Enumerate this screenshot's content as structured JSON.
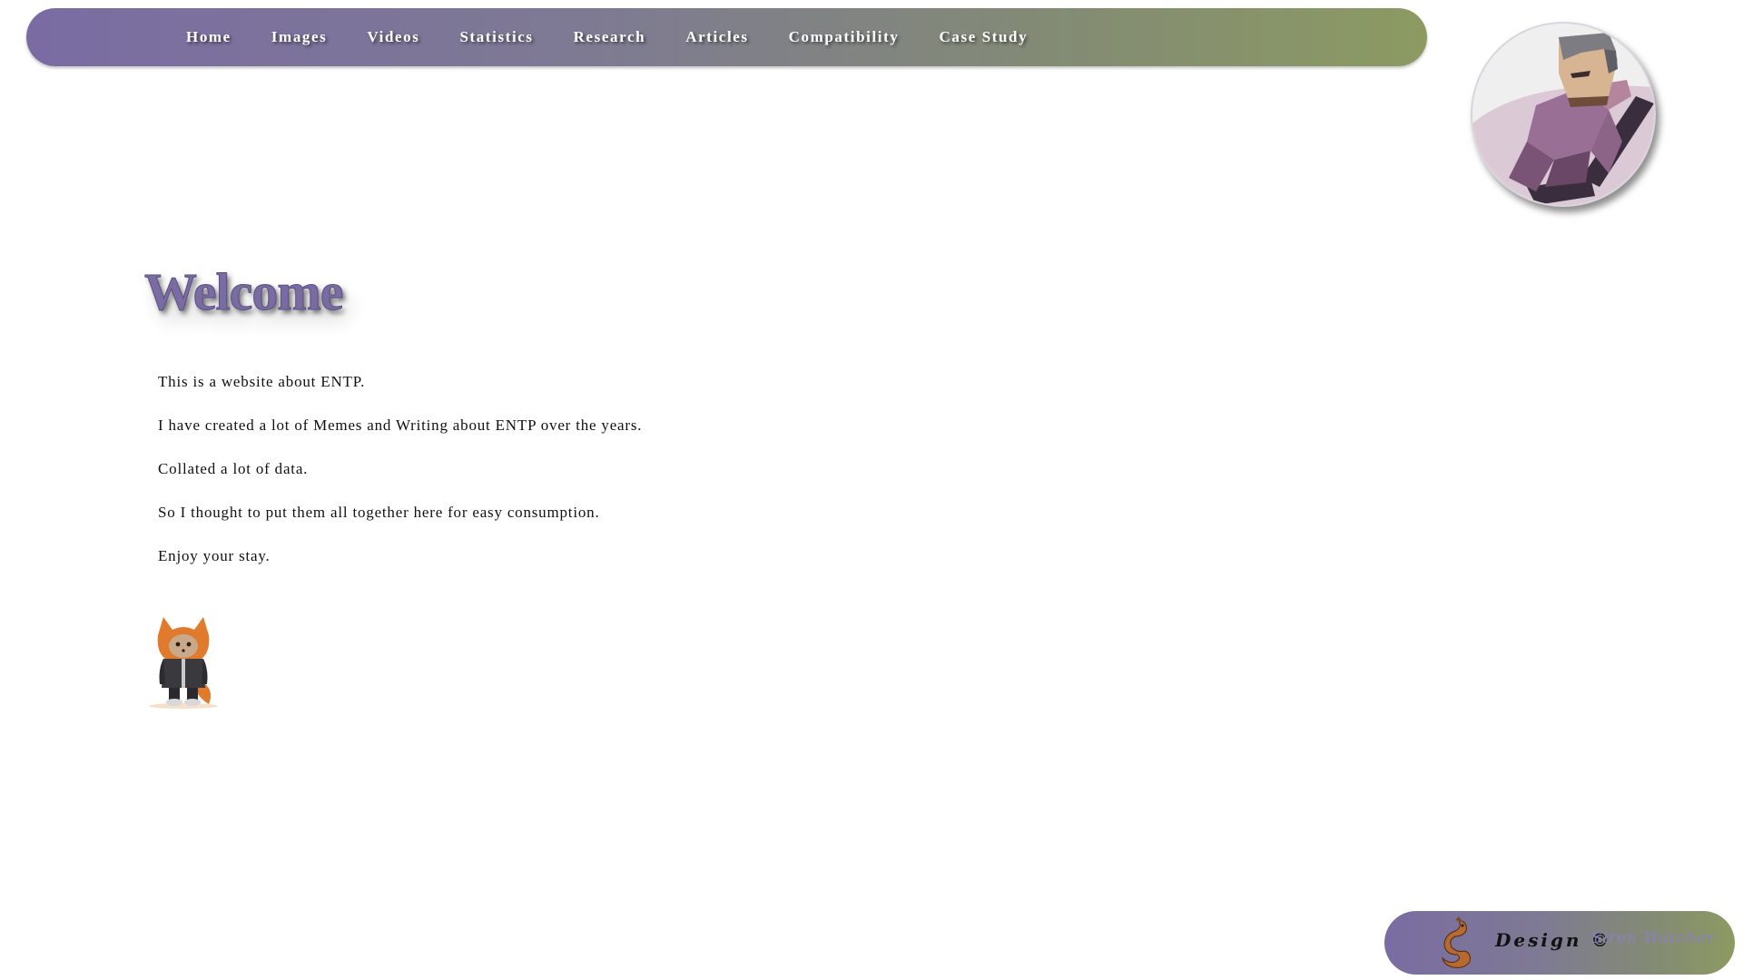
{
  "nav": {
    "items": [
      {
        "label": "Home"
      },
      {
        "label": "Images"
      },
      {
        "label": "Videos"
      },
      {
        "label": "Statistics"
      },
      {
        "label": "Research"
      },
      {
        "label": "Articles"
      },
      {
        "label": "Compatibility"
      },
      {
        "label": "Case Study"
      }
    ]
  },
  "main": {
    "heading": "Welcome",
    "paragraphs": [
      "This is a website about ENTP.",
      "I have created a lot of Memes and Writing about ENTP over the years.",
      "Collated a lot of data.",
      "So I thought to put them all together here for easy consumption.",
      "Enjoy your stay."
    ]
  },
  "footer": {
    "design_label": "Design ©",
    "author": "Siren Watcher"
  },
  "colors": {
    "accent_purple": "#7a6ca3",
    "accent_olive": "#8c9a62"
  },
  "icons": {
    "avatar": "lowpoly-man-reclining-avatar",
    "fox": "hooded-fox-character-image",
    "footer_logo": "dragon-logo"
  }
}
